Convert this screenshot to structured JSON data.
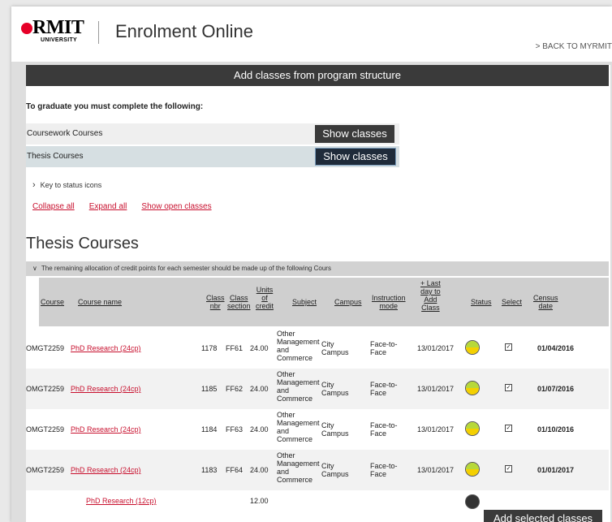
{
  "header": {
    "logo_text": "RMIT",
    "logo_sub": "UNIVERSITY",
    "app_title": "Enrolment Online",
    "back_link": "> BACK TO MYRMIT"
  },
  "banner": "Add classes from program structure",
  "graduate_title": "To graduate you must complete the following:",
  "requirements": [
    {
      "label": "Coursework Courses",
      "button": "Show classes"
    },
    {
      "label": "Thesis Courses",
      "button": "Show classes"
    }
  ],
  "key_label": "Key to status icons",
  "links": {
    "collapse": "Collapse all",
    "expand": "Expand all",
    "open": "Show open classes"
  },
  "section_title": "Thesis Courses",
  "allocation_text": "The remaining allocation of credit points for each semester should be made up of the following Cours",
  "table": {
    "headers": {
      "course": "Course",
      "course_name": "Course name",
      "class_nbr": [
        "Class",
        "nbr"
      ],
      "class_section": [
        "Class",
        "section"
      ],
      "units": [
        "Units",
        "of",
        "credit"
      ],
      "subject": "Subject",
      "campus": "Campus",
      "instruction": [
        "Instruction",
        "mode"
      ],
      "last_day": [
        "+ Last",
        "day to",
        "Add",
        "Class"
      ],
      "status": "Status",
      "select": "Select",
      "census": [
        "Census",
        "date"
      ]
    },
    "rows": [
      {
        "course": "OMGT2259",
        "name": "PhD Research (24cp)",
        "nbr": "1178",
        "section": "FF61",
        "units": "24.00",
        "subject": [
          "Other",
          "Management",
          "and",
          "Commerce"
        ],
        "campus": [
          "City",
          "Campus"
        ],
        "mode": [
          "Face-to-",
          "Face"
        ],
        "last_day": "13/01/2017",
        "census": "01/04/2016"
      },
      {
        "course": "OMGT2259",
        "name": "PhD Research (24cp)",
        "nbr": "1185",
        "section": "FF62",
        "units": "24.00",
        "subject": [
          "Other",
          "Management",
          "and",
          "Commerce"
        ],
        "campus": [
          "City",
          "Campus"
        ],
        "mode": [
          "Face-to-",
          "Face"
        ],
        "last_day": "13/01/2017",
        "census": "01/07/2016"
      },
      {
        "course": "OMGT2259",
        "name": "PhD Research (24cp)",
        "nbr": "1184",
        "section": "FF63",
        "units": "24.00",
        "subject": [
          "Other",
          "Management",
          "and",
          "Commerce"
        ],
        "campus": [
          "City",
          "Campus"
        ],
        "mode": [
          "Face-to-",
          "Face"
        ],
        "last_day": "13/01/2017",
        "census": "01/10/2016"
      },
      {
        "course": "OMGT2259",
        "name": "PhD Research (24cp)",
        "nbr": "1183",
        "section": "FF64",
        "units": "24.00",
        "subject": [
          "Other",
          "Management",
          "and",
          "Commerce"
        ],
        "campus": [
          "City",
          "Campus"
        ],
        "mode": [
          "Face-to-",
          "Face"
        ],
        "last_day": "13/01/2017",
        "census": "01/01/2017"
      }
    ],
    "last_row": {
      "name": "PhD Research (12cp)",
      "units": "12.00"
    }
  },
  "add_button": "Add selected classes"
}
